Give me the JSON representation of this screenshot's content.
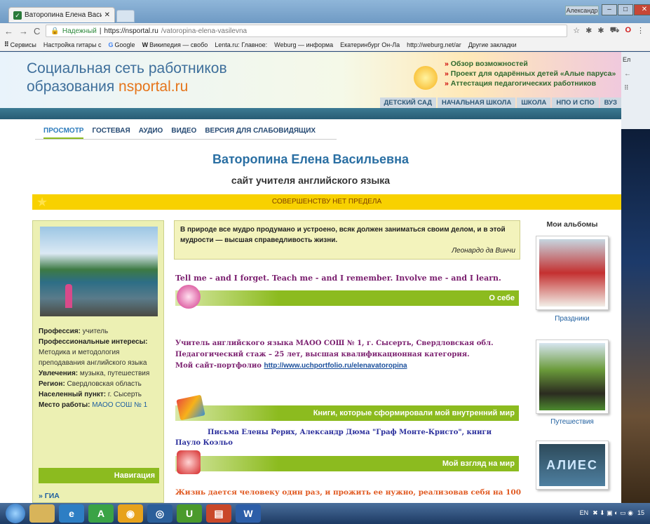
{
  "browser": {
    "tab_title": "Ваторопина Елена Васи",
    "user_tag": "Александр",
    "secure_label": "Надежный",
    "url_host": "https://nsportal.ru",
    "url_path": "/vatoropina-elena-vasilevna",
    "bookmarks": [
      "Сервисы",
      "Настройка гитары с",
      "Google",
      "Википедия — свобо",
      "Lenta.ru: Главное:",
      "Weburg — информа",
      "Екатеринбург Он-Ла",
      "http://weburg.net/ar"
    ],
    "bookmarks_other": "Другие закладки"
  },
  "header": {
    "brand_line1": "Социальная сеть работников",
    "brand_line2_prefix": "образования ",
    "brand_line2_accent": "nsportal.ru",
    "links": [
      "Обзор возможностей",
      "Проект для одарённых детей «Алые паруса»",
      "Аттестация педагогических работников"
    ],
    "levels": [
      "ДЕТСКИЙ САД",
      "НАЧАЛЬНАЯ ШКОЛА",
      "ШКОЛА",
      "НПО И СПО",
      "ВУЗ"
    ]
  },
  "subnav": [
    "ПРОСМОТР",
    "ГОСТЕВАЯ",
    "АУДИО",
    "ВИДЕО",
    "ВЕРСИЯ ДЛЯ СЛАБОВИДЯЩИХ"
  ],
  "profile_name": "Ваторопина Елена Васильевна",
  "role": "сайт учителя английского языка",
  "motto": "СОВЕРШЕНСТВУ НЕТ ПРЕДЕЛА",
  "profile": {
    "prof_label": "Профессия:",
    "prof_value": " учитель",
    "interests_label": "Профессиональные интересы:",
    "interests_value": " Методика и методология преподавания английского языка",
    "hobby_label": "Увлечения:",
    "hobby_value": " музыка, путешествия",
    "region_label": "Регион:",
    "region_value": " Свердловская область",
    "city_label": "Населенный пункт:",
    "city_value": " г. Сысерть",
    "work_label": "Место работы:",
    "work_value": " МАОО СОШ № 1"
  },
  "nav": {
    "heading": "Навигация",
    "item": "ГИА"
  },
  "quote": {
    "text": "В природе все мудро продумано и устроено, всяк должен заниматься своим делом, и в этой мудрости — высшая справедливость жизни.",
    "author": "Леонардо да Винчи"
  },
  "eng_quote": "Tell me - and I forget. Teach me - and I remember. Involve me - and I learn.",
  "sections": {
    "about": "О себе",
    "books": "Книги, которые сформировали мой внутренний мир",
    "view": "Мой взгляд на мир"
  },
  "about": {
    "line1": "Учитель английского языка МАОО СОШ № 1, г. Сысерть, Свердловская обл.",
    "line2": "Педагогический стаж – 25 лет, высшая квалификационная категория.",
    "line3": "Мой сайт-портфолио ",
    "link": "http://www.uchportfolio.ru/elenavatoropina"
  },
  "books": "Письма Елены Рерих, Александр Дюма \"Граф Монте-Кристо\", книги Пауло Коэльо",
  "life": "Жизнь дается человеку один раз, и прожить ее нужно, реализовав себя  на 100",
  "albums": {
    "heading": "Мои альбомы",
    "items": [
      "Праздники",
      "Путешествия"
    ],
    "third_caption": "АЛИЕС"
  },
  "taskbar": {
    "lang": "EN",
    "time": "15"
  }
}
